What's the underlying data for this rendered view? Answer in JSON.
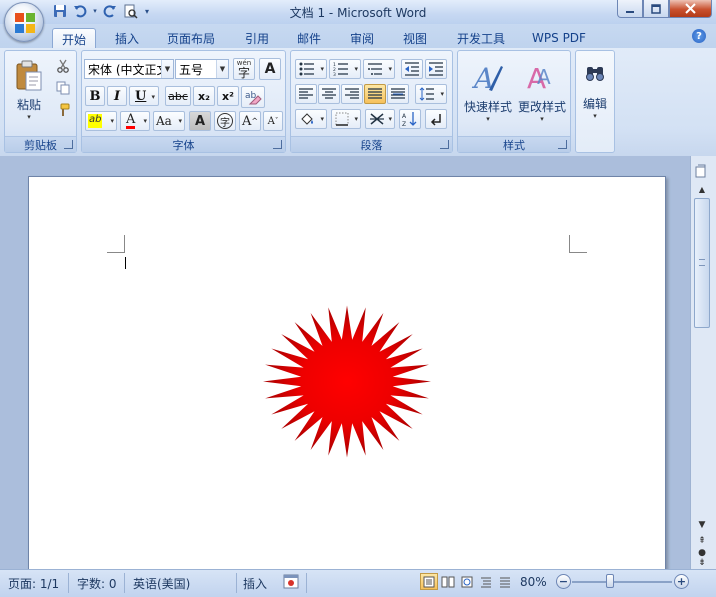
{
  "app": {
    "title": "文档 1 - Microsoft Word",
    "office_button_icon": "office-logo-icon"
  },
  "quick_access": [
    {
      "name": "save",
      "icon": "save-icon"
    },
    {
      "name": "undo",
      "icon": "undo-icon"
    },
    {
      "name": "redo",
      "icon": "redo-icon"
    },
    {
      "name": "print-preview",
      "icon": "print-preview-icon"
    },
    {
      "name": "customize",
      "icon": "dropdown-icon"
    }
  ],
  "tabs": [
    "开始",
    "插入",
    "页面布局",
    "引用",
    "邮件",
    "审阅",
    "视图",
    "开发工具",
    "WPS PDF"
  ],
  "active_tab": 0,
  "ribbon": {
    "clipboard": {
      "label": "剪贴板",
      "paste_label": "粘贴"
    },
    "font": {
      "label": "字体",
      "font_name": "宋体 (中文正文",
      "font_size": "五号",
      "phonetic_top": "wén",
      "phonetic_char": "字",
      "char_border": "A",
      "bold": "B",
      "italic": "I",
      "underline": "U",
      "strike": "abc",
      "subscript": "x₂",
      "superscript": "x²",
      "highlight": "ab",
      "font_color": "A",
      "change_case": "Aa",
      "char_shading": "A",
      "enclose": "字",
      "grow": "A",
      "shrink": "A"
    },
    "paragraph": {
      "label": "段落"
    },
    "styles": {
      "label": "样式",
      "quick_styles": "快速样式",
      "change_styles": "更改样式"
    },
    "editing": {
      "label": "编辑"
    }
  },
  "document": {
    "shape": "red-starburst",
    "shape_color": "#ff0000",
    "shape_dark_color": "#b80000"
  },
  "status": {
    "page": "页面: 1/1",
    "words": "字数: 0",
    "language": "英语(美国)",
    "mode": "插入",
    "zoom": "80%",
    "zoom_minus": "−",
    "zoom_plus": "+"
  },
  "colors": {
    "ribbon_text": "#15428b",
    "highlight_yellow": "#ffff00",
    "font_color_red": "#ff0000"
  }
}
